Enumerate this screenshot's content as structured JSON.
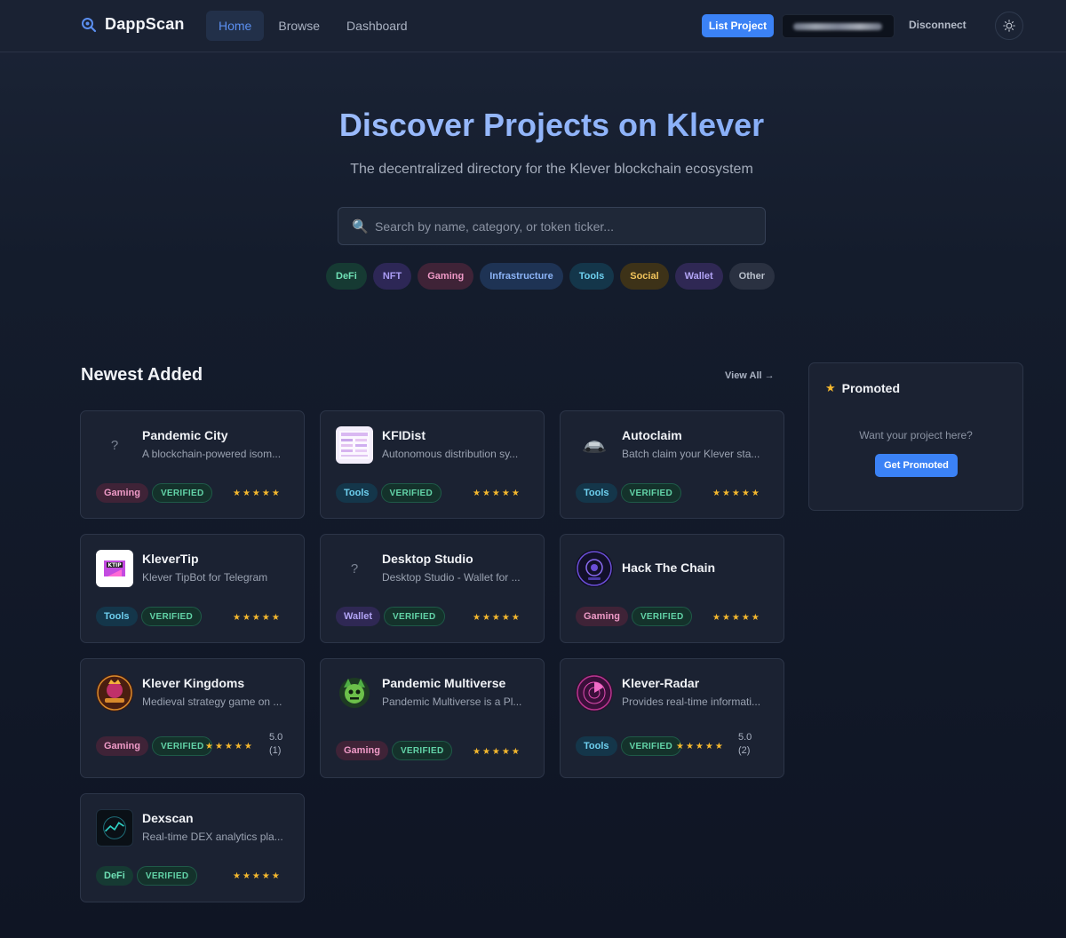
{
  "header": {
    "logo_text": "DappScan",
    "nav": [
      {
        "label": "Home",
        "active": true
      },
      {
        "label": "Browse",
        "active": false
      },
      {
        "label": "Dashboard",
        "active": false
      }
    ],
    "list_project_label": "List Project",
    "disconnect_label": "Disconnect"
  },
  "hero": {
    "title": "Discover Projects on Klever",
    "subtitle": "The decentralized directory for the Klever blockchain ecosystem",
    "search_placeholder": "Search by name, category, or token ticker...",
    "categories": [
      "DeFi",
      "NFT",
      "Gaming",
      "Infrastructure",
      "Tools",
      "Social",
      "Wallet",
      "Other"
    ]
  },
  "section": {
    "title": "Newest Added",
    "view_all_label": "View All →"
  },
  "projects": [
    {
      "name": "Pandemic City",
      "desc": "A blockchain-powered isom...",
      "tag": "Gaming",
      "verified": "VERIFIED",
      "stars": "★★★★★",
      "rating": "",
      "votes": ""
    },
    {
      "name": "KFIDist",
      "desc": "Autonomous distribution sy...",
      "tag": "Tools",
      "verified": "VERIFIED",
      "stars": "★★★★★",
      "rating": "",
      "votes": ""
    },
    {
      "name": "Autoclaim",
      "desc": "Batch claim your Klever sta...",
      "tag": "Tools",
      "verified": "VERIFIED",
      "stars": "★★★★★",
      "rating": "",
      "votes": ""
    },
    {
      "name": "KleverTip",
      "desc": "Klever TipBot for Telegram",
      "tag": "Tools",
      "verified": "VERIFIED",
      "stars": "★★★★★",
      "rating": "",
      "votes": ""
    },
    {
      "name": "Desktop Studio",
      "desc": "Desktop Studio - Wallet for ...",
      "tag": "Wallet",
      "verified": "VERIFIED",
      "stars": "★★★★★",
      "rating": "",
      "votes": ""
    },
    {
      "name": "Hack The Chain",
      "desc": "",
      "tag": "Gaming",
      "verified": "VERIFIED",
      "stars": "★★★★★",
      "rating": "",
      "votes": ""
    },
    {
      "name": "Klever Kingdoms",
      "desc": "Medieval strategy game on ...",
      "tag": "Gaming",
      "verified": "VERIFIED",
      "stars": "★★★★★",
      "rating": "5.0",
      "votes": "(1)"
    },
    {
      "name": "Pandemic Multiverse",
      "desc": "Pandemic Multiverse is a Pl...",
      "tag": "Gaming",
      "verified": "VERIFIED",
      "stars": "★★★★★",
      "rating": "",
      "votes": ""
    },
    {
      "name": "Klever-Radar",
      "desc": "Provides real-time informati...",
      "tag": "Tools",
      "verified": "VERIFIED",
      "stars": "★★★★★",
      "rating": "5.0",
      "votes": "(2)"
    },
    {
      "name": "Dexscan",
      "desc": "Real-time DEX analytics pla...",
      "tag": "DeFi",
      "verified": "VERIFIED",
      "stars": "★★★★★",
      "rating": "",
      "votes": ""
    }
  ],
  "promoted": {
    "title": "Promoted",
    "text": "Want your project here?",
    "button_label": "Get Promoted"
  }
}
